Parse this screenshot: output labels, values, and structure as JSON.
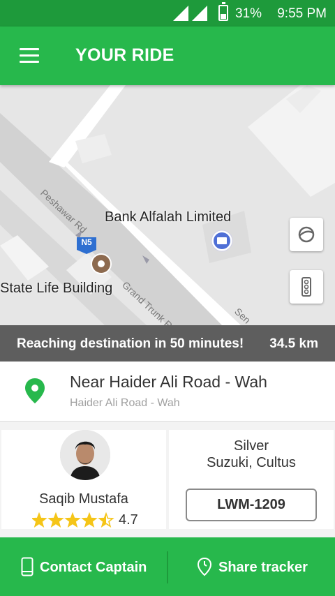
{
  "status_bar": {
    "battery": "31%",
    "time": "9:55 PM",
    "icons": [
      "signal-icon",
      "signal-icon",
      "battery-icon"
    ]
  },
  "app_bar": {
    "title": "YOUR RIDE",
    "menu_icon": "hamburger-menu-icon"
  },
  "map": {
    "places": [
      "Bank Alfalah Limited",
      "State Life Building"
    ],
    "roads": [
      "Peshawar Rd",
      "Grand Trunk R",
      "Sen"
    ],
    "highway_shield": "N5",
    "buttons": [
      "google-earth-icon",
      "traffic-light-icon"
    ]
  },
  "eta": {
    "text": "Reaching destination in 50 minutes!",
    "distance": "34.5 km"
  },
  "destination": {
    "title": "Near Haider Ali Road - Wah",
    "subtitle": "Haider Ali Road - Wah"
  },
  "driver": {
    "name": "Saqib Mustafa",
    "rating": "4.7",
    "stars_value": 4.5,
    "stars_max": 5
  },
  "vehicle": {
    "color": "Silver",
    "model": "Suzuki, Cultus",
    "plate": "LWM-1209"
  },
  "actions": {
    "contact_label": "Contact Captain",
    "share_label": "Share tracker"
  },
  "colors": {
    "primary": "#27b84c",
    "primary_dark": "#1e9a3b",
    "star": "#f5c518",
    "eta_banner": "#5e5e5e"
  }
}
